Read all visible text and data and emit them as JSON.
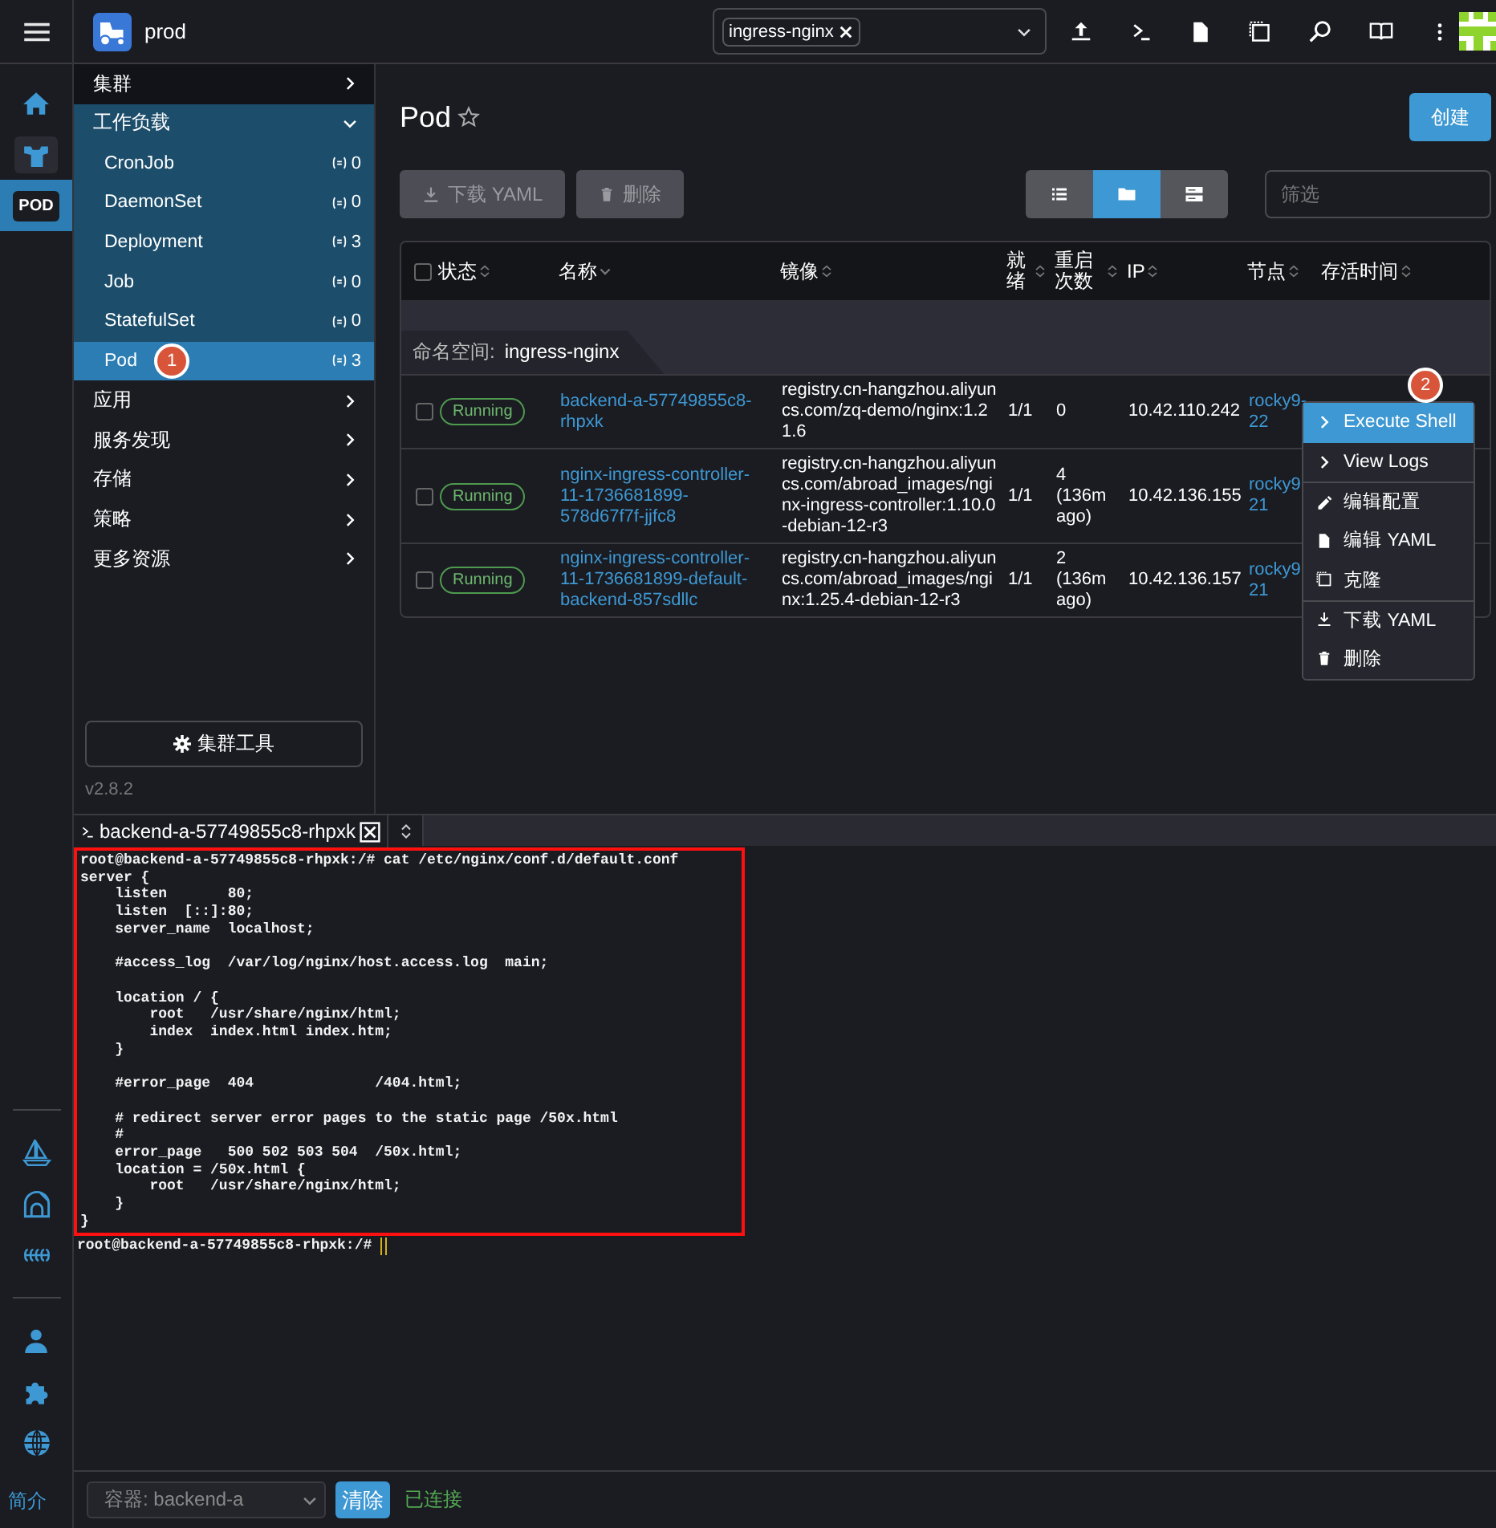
{
  "header": {
    "cluster": "prod",
    "namespace_chip": "ingress-nginx"
  },
  "rail": {
    "items": [
      {
        "selected": false
      },
      {
        "selected": false
      },
      {
        "label": "POD",
        "selected": true
      }
    ],
    "about": "简介"
  },
  "sidebar": {
    "groups": [
      {
        "label": "集群",
        "expanded": false
      },
      {
        "label": "工作负载",
        "expanded": true,
        "children": [
          {
            "label": "CronJob",
            "count": "0",
            "selected": false
          },
          {
            "label": "DaemonSet",
            "count": "0",
            "selected": false
          },
          {
            "label": "Deployment",
            "count": "3",
            "selected": false
          },
          {
            "label": "Job",
            "count": "0",
            "selected": false
          },
          {
            "label": "StatefulSet",
            "count": "0",
            "selected": false
          },
          {
            "label": "Pod",
            "count": "3",
            "selected": true
          }
        ]
      },
      {
        "label": "应用",
        "expanded": false
      },
      {
        "label": "服务发现",
        "expanded": false
      },
      {
        "label": "存储",
        "expanded": false
      },
      {
        "label": "策略",
        "expanded": false
      },
      {
        "label": "更多资源",
        "expanded": false
      }
    ],
    "tools_button": "集群工具",
    "version": "v2.8.2"
  },
  "page": {
    "title": "Pod",
    "starred": false,
    "create_button": "创建",
    "actions": [
      {
        "label": "下载 YAML",
        "disabled": true
      },
      {
        "label": "删除",
        "disabled": true
      }
    ],
    "views": [
      {
        "selected": false
      },
      {
        "selected": true
      },
      {
        "selected": false
      }
    ],
    "filter": {
      "placeholder": "筛选"
    }
  },
  "table": {
    "select_all": {
      "checked": false
    },
    "columns": [
      {
        "label": "状态",
        "sorted": false
      },
      {
        "label": "名称",
        "sorted": true
      },
      {
        "label": "镜像",
        "sorted": false
      },
      {
        "label": "就绪",
        "sorted": false
      },
      {
        "label": "重启次数",
        "sorted": false
      },
      {
        "label": "IP",
        "sorted": false
      },
      {
        "label": "节点",
        "sorted": false
      },
      {
        "label": "存活时间",
        "sorted": false
      }
    ],
    "group": {
      "label": "命名空间:",
      "value": "ingress-nginx"
    },
    "rows": [
      {
        "checked": false,
        "status": "Running",
        "name": "backend-a-57749855c8-rhpxk",
        "image": "registry.cn-hangzhou.aliyuncs.com/zq-demo/nginx:1.21.6",
        "ready": "1/1",
        "restarts": "0",
        "ip": "10.42.110.242",
        "node": "rocky9-22"
      },
      {
        "checked": false,
        "status": "Running",
        "name": "nginx-ingress-controller-11-1736681899-578d67f7f-jjfc8",
        "image": "registry.cn-hangzhou.aliyuncs.com/abroad_images/nginx-ingress-controller:1.10.0-debian-12-r3",
        "ready": "1/1",
        "restarts": "4 (136m ago)",
        "ip": "10.42.136.155",
        "node": "rocky9 21"
      },
      {
        "checked": false,
        "status": "Running",
        "name": "nginx-ingress-controller-11-1736681899-default-backend-857sdllc",
        "image": "registry.cn-hangzhou.aliyuncs.com/abroad_images/nginx:1.25.4-debian-12-r3",
        "ready": "1/1",
        "restarts": "2 (136m ago)",
        "ip": "10.42.136.157",
        "node": "rocky9 21"
      }
    ]
  },
  "context_menu": {
    "items": [
      {
        "label": "Execute Shell",
        "selected": true
      },
      {
        "label": "View Logs",
        "selected": false
      },
      {
        "label": "编辑配置",
        "selected": false
      },
      {
        "label": "编辑 YAML",
        "selected": false
      },
      {
        "label": "克隆",
        "selected": false
      },
      {
        "label": "下载 YAML",
        "selected": false
      },
      {
        "label": "删除",
        "selected": false
      }
    ]
  },
  "annotations": [
    "1",
    "2"
  ],
  "terminal": {
    "tab": "backend-a-57749855c8-rhpxk",
    "output": "root@backend-a-57749855c8-rhpxk:/# cat /etc/nginx/conf.d/default.conf\nserver {\n    listen       80;\n    listen  [::]:80;\n    server_name  localhost;\n\n    #access_log  /var/log/nginx/host.access.log  main;\n\n    location / {\n        root   /usr/share/nginx/html;\n        index  index.html index.htm;\n    }\n\n    #error_page  404              /404.html;\n\n    # redirect server error pages to the static page /50x.html\n    #\n    error_page   500 502 503 504  /50x.html;\n    location = /50x.html {\n        root   /usr/share/nginx/html;\n    }\n}",
    "prompt": "root@backend-a-57749855c8-rhpxk:/#"
  },
  "footer": {
    "container_select": "容器: backend-a",
    "clear_button": "清除",
    "status": "已连接"
  }
}
